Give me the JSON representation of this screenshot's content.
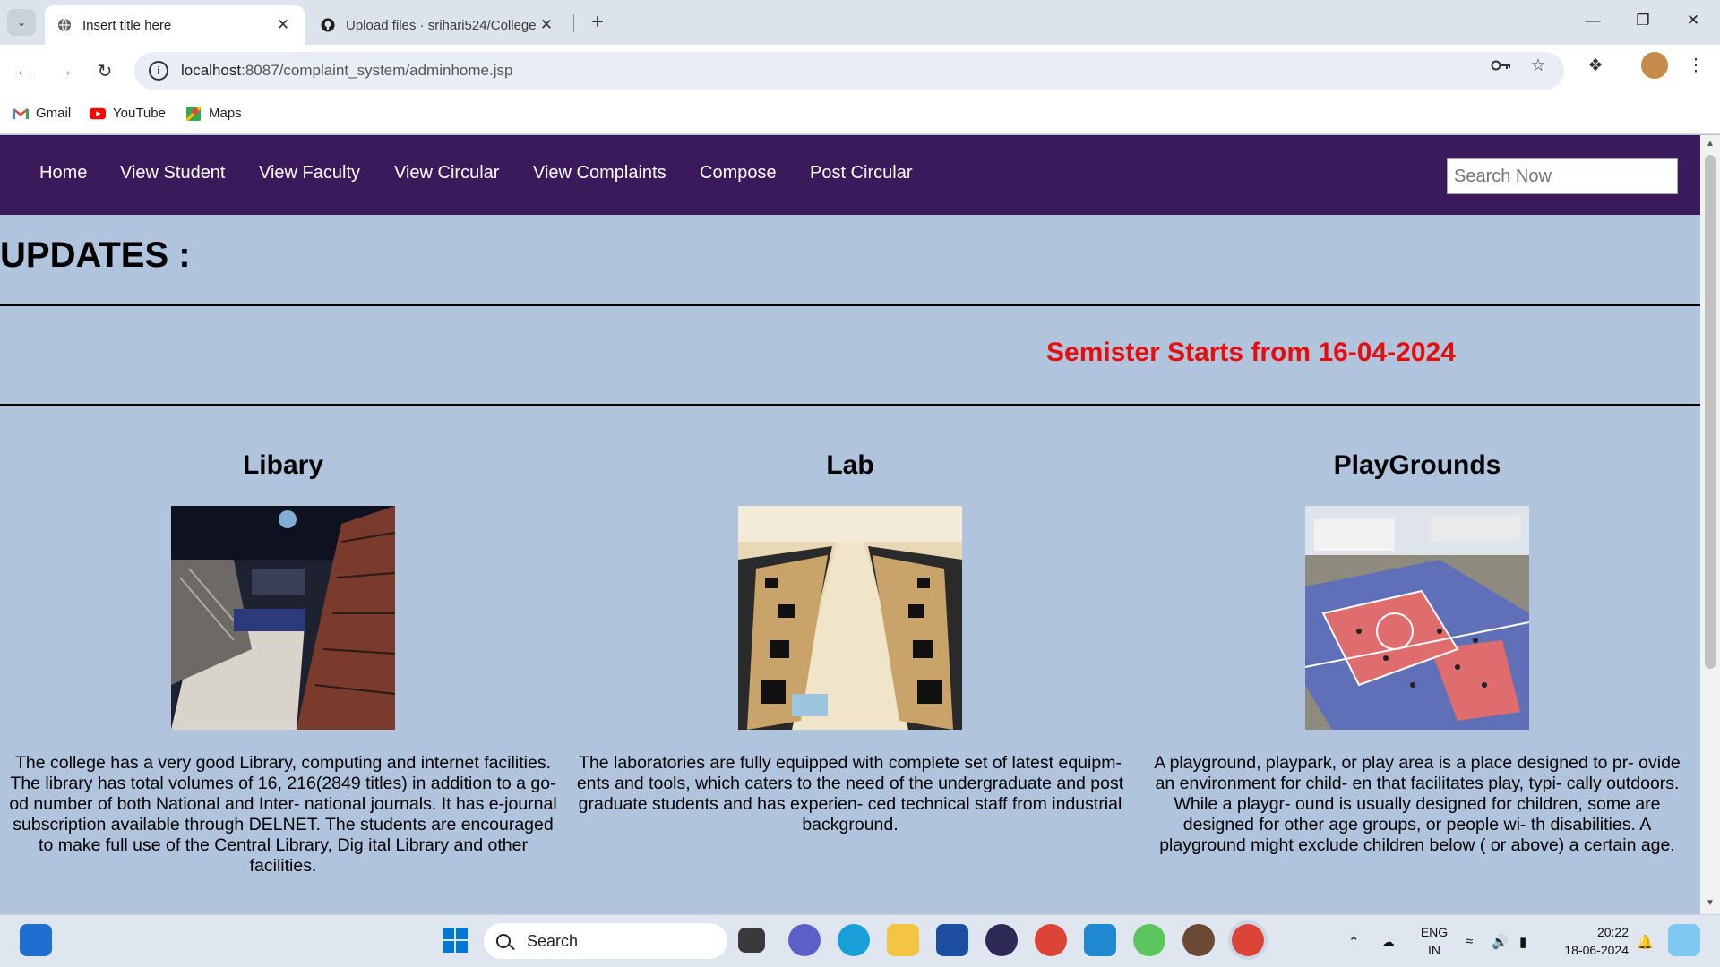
{
  "browser": {
    "tabs": [
      {
        "title": "Insert title here",
        "active": true
      },
      {
        "title": "Upload files · srihari524/College",
        "active": false
      }
    ],
    "url_host": "localhost",
    "url_path": ":8087/complaint_system/adminhome.jsp",
    "bookmarks": [
      "Gmail",
      "YouTube",
      "Maps"
    ]
  },
  "nav": {
    "links": [
      "Home",
      "View Student",
      "View Faculty",
      "View Circular",
      "View Complaints",
      "Compose",
      "Post Circular"
    ],
    "search_placeholder": "Search Now"
  },
  "page": {
    "updates_heading": "UPDATES :",
    "announcement": "Semister Starts from 16-04-2024",
    "columns": [
      {
        "title": "Libary",
        "image": "library-photo",
        "text": "The college has a very good Library, computing and internet facilities. The library has total volumes of 16, 216(2849 titles) in addition to a go- od number of both National and Inter- national journals. It has e-journal subscription available through DELNET. The students are encouraged to make full use of the Central Library, Dig ital Library and other facilities."
      },
      {
        "title": "Lab",
        "image": "computer-lab-photo",
        "text": "The laboratories are fully equipped with complete set of latest equipm- ents and tools, which caters to the need of the undergraduate and post graduate students and has experien- ced technical staff from industrial background."
      },
      {
        "title": "PlayGrounds",
        "image": "playground-photo",
        "text": "A playground, playpark, or play area is a place designed to pr- ovide an environment for child- en that facilitates play, typi- cally outdoors. While a playgr- ound is usually designed for children, some are designed for other age groups, or people wi- th disabilities. A playground might exclude children below ( or above) a certain age."
      }
    ]
  },
  "taskbar": {
    "search_label": "Search",
    "lang": "ENG",
    "region": "IN",
    "time": "20:22",
    "date": "18-06-2024"
  },
  "colors": {
    "navbar": "#3b1a5c",
    "page_background": "#b0c4de",
    "announcement": "#e60d0d"
  }
}
